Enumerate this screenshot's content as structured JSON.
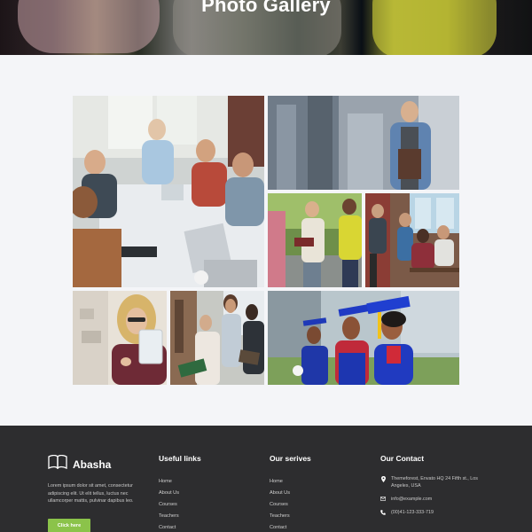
{
  "hero": {
    "title": "Photo Gallery"
  },
  "gallery": {
    "tiles": [
      {
        "id": "classroom-group-meeting"
      },
      {
        "id": "student-holding-book"
      },
      {
        "id": "students-walking"
      },
      {
        "id": "students-at-desk"
      },
      {
        "id": "student-with-tablet"
      },
      {
        "id": "students-reading"
      },
      {
        "id": "graduates-caps"
      }
    ]
  },
  "footer": {
    "brand": {
      "name": "Abasha",
      "icon": "book-icon",
      "about": "Lorem ipsum dolor sit amet, consectetur adipiscing elit. Ut elit tellus, luctus nec ullamcorper mattis, pulvinar dapibus leo.",
      "cta": "Click here"
    },
    "useful_links": {
      "title": "Useful links",
      "items": [
        "Home",
        "About Us",
        "Courses",
        "Teachers",
        "Contact"
      ]
    },
    "services": {
      "title": "Our serives",
      "items": [
        "Home",
        "About Us",
        "Courses",
        "Teachers",
        "Contact"
      ]
    },
    "contact": {
      "title": "Our Contact",
      "address": "Themeforest, Envato HQ 24 Fifth st., Los Angeles, USA",
      "email": "info@example.com",
      "phone": "(00)41-123-333-719"
    }
  },
  "colors": {
    "accent": "#8bc34a",
    "footer_bg": "#2d2d2f",
    "page_bg": "#f4f5f8"
  }
}
